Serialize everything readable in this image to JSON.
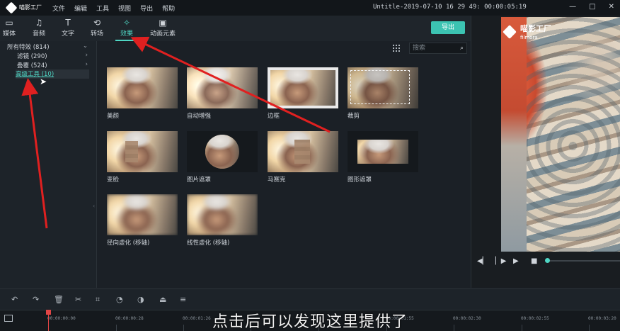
{
  "app": {
    "logo_text": "喵影工厂",
    "project_title": "Untitle-2019-07-10 16 29 49: 00:00:05:19"
  },
  "menu": [
    "文件",
    "编辑",
    "工具",
    "视图",
    "导出",
    "帮助"
  ],
  "window_controls": [
    "—",
    "□",
    "✕"
  ],
  "tabs": [
    {
      "label": "媒体",
      "icon": "folder-icon"
    },
    {
      "label": "音频",
      "icon": "music-note-icon"
    },
    {
      "label": "文字",
      "icon": "text-icon"
    },
    {
      "label": "转场",
      "icon": "transition-icon"
    },
    {
      "label": "效果",
      "icon": "effects-icon",
      "active": true
    },
    {
      "label": "动画元素",
      "icon": "image-icon"
    }
  ],
  "export_label": "导出",
  "categories": {
    "root": "所有特效 (814)",
    "items": [
      "滤镜 (290)",
      "叠覆 (524)",
      "高级工具 (10)"
    ]
  },
  "search": {
    "placeholder": "搜索"
  },
  "effects": [
    "美颜",
    "自动增强",
    "边框",
    "裁剪",
    "变脸",
    "图片遮罩",
    "马赛克",
    "图形遮罩",
    "径向虚化 (移轴)",
    "线性虚化 (移轴)"
  ],
  "preview": {
    "watermark_cn": "喵影工厂",
    "watermark_en": "filmora",
    "progress": 0.0
  },
  "timeline": {
    "timecodes": [
      "00:00:00:00",
      "00:00:00:28",
      "00:00:01:26",
      "00:00:01:55",
      "00:00:02:30",
      "00:00:02:55",
      "00:00:03:20"
    ]
  },
  "subtitle": "点击后可以发现这里提供了",
  "colors": {
    "accent": "#4fd6c4",
    "export": "#3cc3b2",
    "arrow": "#e02020",
    "playhead": "#e04545"
  }
}
